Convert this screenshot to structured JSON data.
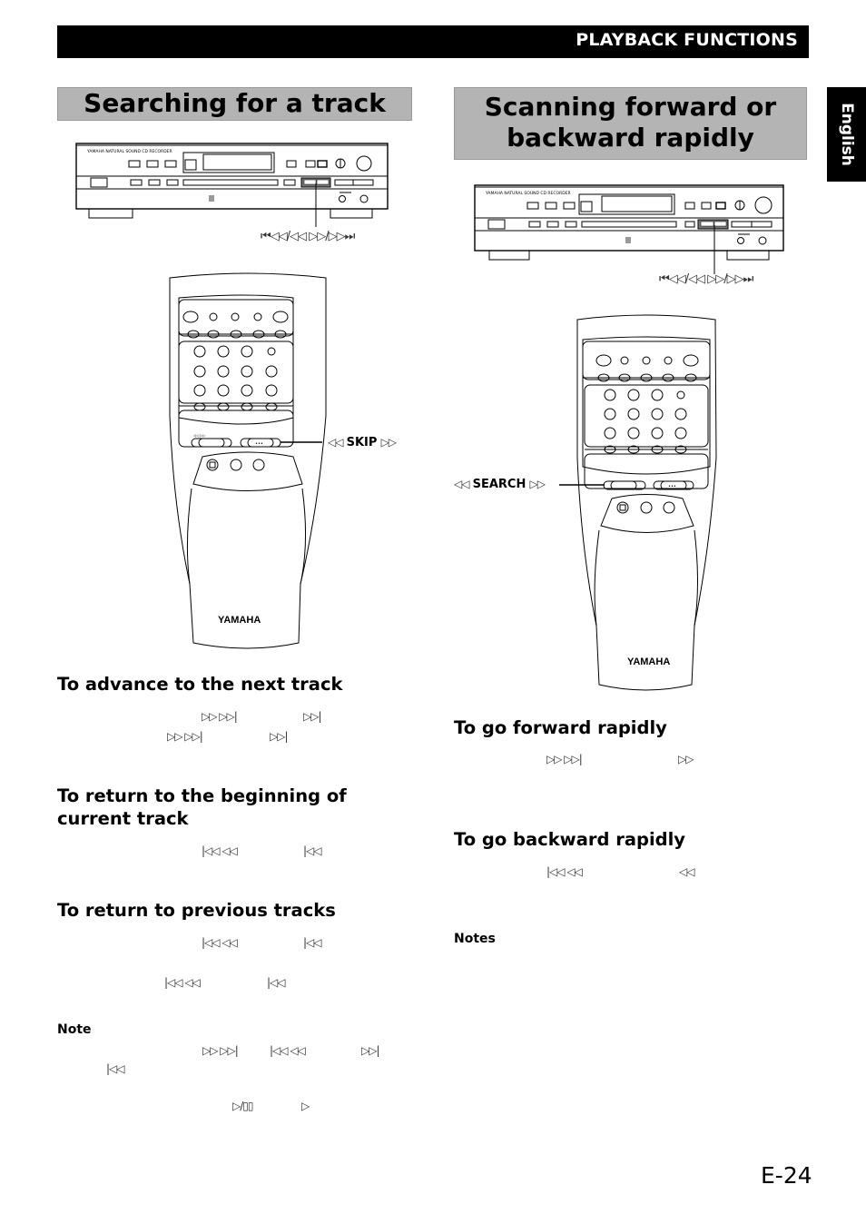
{
  "header": {
    "section_title": "PLAYBACK FUNCTIONS"
  },
  "language_tab": "English",
  "left_column": {
    "title": "Searching for a track",
    "front_panel_callout": "⏮◁◁/◁◁  ▷▷/▷▷⏭",
    "remote_callout": {
      "prefix": "◁◁",
      "label": "SKIP",
      "suffix": "▷▷"
    },
    "remote_brand": "YAMAHA",
    "sections": [
      {
        "heading": "To advance to the next track",
        "symbol_lines": [
          [
            "▷▷ ▷▷|",
            "▷▷|"
          ],
          [
            "▷▷ ▷▷|",
            "▷▷|"
          ]
        ]
      },
      {
        "heading": "To return to the beginning of current track",
        "symbol_lines": [
          [
            "|◁◁ ◁◁",
            "|◁◁"
          ]
        ]
      },
      {
        "heading": "To return to previous tracks",
        "symbol_lines": [
          [
            "|◁◁ ◁◁",
            "|◁◁"
          ],
          [
            "|◁◁ ◁◁",
            "|◁◁"
          ]
        ]
      }
    ],
    "note": {
      "heading": "Note",
      "symbol_lines": [
        [
          "▷▷ ▷▷|",
          "|◁◁ ◁◁",
          "▷▷|"
        ],
        [
          "|◁◁"
        ],
        [
          "▷/▯▯",
          "▷"
        ]
      ]
    }
  },
  "right_column": {
    "title": "Scanning forward or backward rapidly",
    "front_panel_callout": "⏮◁◁/◁◁  ▷▷/▷▷⏭",
    "remote_callout": {
      "prefix": "◁◁",
      "label": "SEARCH",
      "suffix": "▷▷"
    },
    "remote_brand": "YAMAHA",
    "sections": [
      {
        "heading": "To go forward rapidly",
        "symbol_lines": [
          [
            "▷▷ ▷▷|",
            "▷▷"
          ]
        ]
      },
      {
        "heading": "To go backward rapidly",
        "symbol_lines": [
          [
            "|◁◁ ◁◁",
            "◁◁"
          ]
        ]
      }
    ],
    "notes_heading": "Notes"
  },
  "page_number": "E-24"
}
